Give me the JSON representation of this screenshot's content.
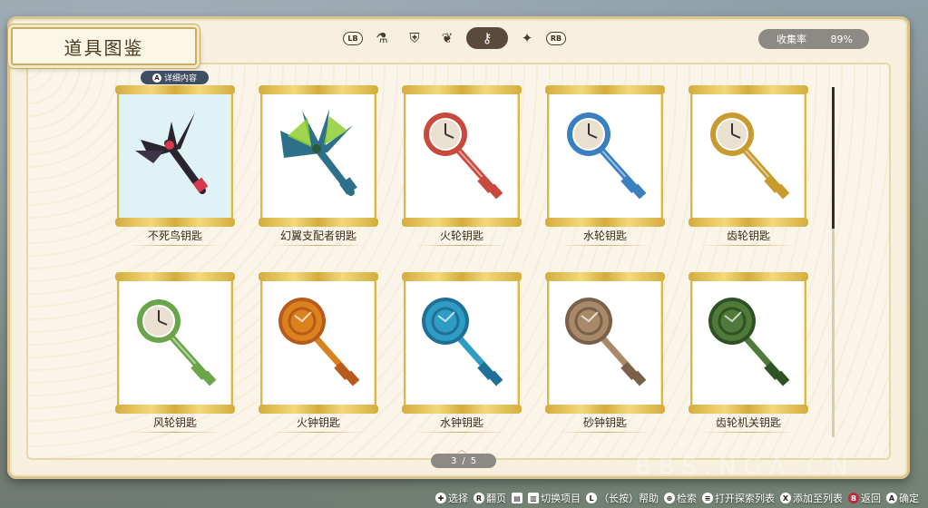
{
  "screen_title": "道具图鉴",
  "tabs": {
    "lb": "LB",
    "rb": "RB",
    "items": [
      {
        "icon": "pot-icon",
        "glyph": "⚗",
        "active": false
      },
      {
        "icon": "shield-sword-icon",
        "glyph": "⛨",
        "active": false
      },
      {
        "icon": "berries-icon",
        "glyph": "❦",
        "active": false
      },
      {
        "icon": "keys-icon",
        "glyph": "⚷",
        "active": true
      },
      {
        "icon": "crystal-icon",
        "glyph": "✦",
        "active": false
      }
    ]
  },
  "collection": {
    "label": "收集率",
    "value": "89%"
  },
  "detail_badge": {
    "button": "A",
    "label": "详细内容"
  },
  "items": [
    {
      "name": "不死鸟钥匙",
      "icon": "phoenix-key-icon",
      "color": "#2b2530",
      "accent": "#d43a4a",
      "style": "phoenix"
    },
    {
      "name": "幻翼支配者钥匙",
      "icon": "wing-key-icon",
      "color": "#2e6f8a",
      "accent": "#8fcf2f",
      "style": "wing"
    },
    {
      "name": "火轮钥匙",
      "icon": "fire-wheel-key-icon",
      "color": "#c84a3c",
      "accent": "#e9e0d0",
      "style": "clock"
    },
    {
      "name": "水轮钥匙",
      "icon": "water-wheel-key-icon",
      "color": "#3a7fc0",
      "accent": "#e9e0d0",
      "style": "clock"
    },
    {
      "name": "齿轮钥匙",
      "icon": "gear-key-icon",
      "color": "#c99a2e",
      "accent": "#e9e0d0",
      "style": "clock"
    },
    {
      "name": "风轮钥匙",
      "icon": "wind-wheel-key-icon",
      "color": "#6aa54a",
      "accent": "#e9e0d0",
      "style": "clock"
    },
    {
      "name": "火钟钥匙",
      "icon": "fire-bell-key-icon",
      "color": "#d9821e",
      "accent": "#b85a1a",
      "style": "bell"
    },
    {
      "name": "水钟钥匙",
      "icon": "water-bell-key-icon",
      "color": "#2f9cc4",
      "accent": "#1f6f96",
      "style": "bell"
    },
    {
      "name": "砂钟钥匙",
      "icon": "sand-bell-key-icon",
      "color": "#a88a6a",
      "accent": "#7a6048",
      "style": "bell"
    },
    {
      "name": "齿轮机关钥匙",
      "icon": "gear-mechanism-key-icon",
      "color": "#4f7a3a",
      "accent": "#2f5224",
      "style": "bell"
    }
  ],
  "pager": {
    "current": "3",
    "separator": "/",
    "total": "5"
  },
  "footer": [
    {
      "button": "✚",
      "label": "选择",
      "shape": "round"
    },
    {
      "button": "R",
      "label": "翻页",
      "shape": "round"
    },
    {
      "button": "▤",
      "label": "",
      "shape": "sq"
    },
    {
      "button": "▥",
      "label": "切换项目",
      "shape": "sq"
    },
    {
      "button": "L",
      "label": "（长按）帮助",
      "shape": "round"
    },
    {
      "button": "⊕",
      "label": "检索",
      "shape": "round"
    },
    {
      "button": "≡",
      "label": "打开探索列表",
      "shape": "round"
    },
    {
      "button": "X",
      "label": "添加至列表",
      "shape": "round"
    },
    {
      "button": "B",
      "label": "返回",
      "shape": "red"
    },
    {
      "button": "A",
      "label": "确定",
      "shape": "round"
    }
  ],
  "watermark": "BBS.NGA.CN"
}
